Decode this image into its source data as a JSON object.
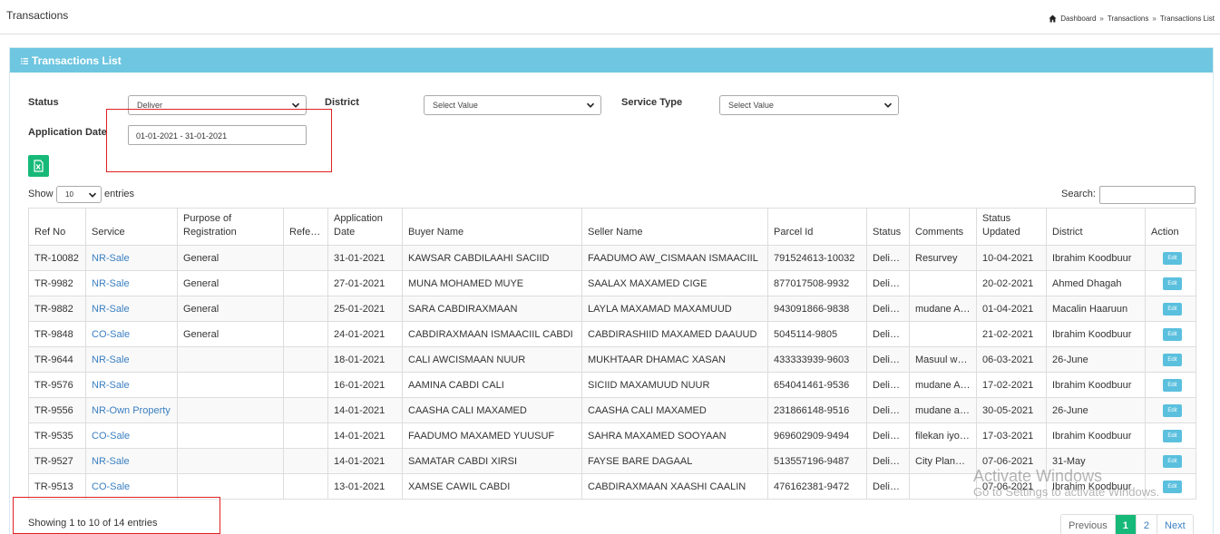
{
  "header": {
    "title": "Transactions",
    "breadcrumb": [
      "Dashboard",
      "Transactions",
      "Transactions List"
    ],
    "separator": "»"
  },
  "card": {
    "title": "Transactions List"
  },
  "filters": {
    "status_label": "Status",
    "status_value": "Deliver",
    "district_label": "District",
    "district_value": "Select Value",
    "service_type_label": "Service Type",
    "service_type_value": "Select Value",
    "date_label": "Application Date",
    "date_value": "01-01-2021 - 31-01-2021"
  },
  "table_controls": {
    "show_label": "Show",
    "entries_value": "10",
    "entries_label": "entries",
    "search_label": "Search:"
  },
  "table": {
    "columns": [
      "Ref No",
      "Service",
      "Purpose of Registration",
      "Referral",
      "Application Date",
      "Buyer Name",
      "Seller Name",
      "Parcel Id",
      "Status",
      "Comments",
      "Status Updated",
      "District",
      "Action"
    ],
    "edit_label": "Edit",
    "rows": [
      [
        "TR-10082",
        "NR-Sale",
        "General",
        "",
        "31-01-2021",
        "KAWSAR CABDILAAHI SACIID",
        "FAADUMO AW_CISMAAN ISMAACIIL",
        "791524613-10032",
        "Deliver",
        "Resurvey",
        "10-04-2021",
        "Ibrahim Koodbuur"
      ],
      [
        "TR-9982",
        "NR-Sale",
        "General",
        "",
        "27-01-2021",
        "MUNA MOHAMED MUYE",
        "SAALAX MAXAMED CIGE",
        "877017508-9932",
        "Deliver",
        "",
        "20-02-2021",
        "Ahmed Dhagah"
      ],
      [
        "TR-9882",
        "NR-Sale",
        "General",
        "",
        "25-01-2021",
        "SARA CABDIRAXMAAN",
        "LAYLA MAXAMAD MAXAMUUD",
        "943091866-9838",
        "Deliver",
        "mudane Ag...",
        "01-04-2021",
        "Macalin Haaruun"
      ],
      [
        "TR-9848",
        "CO-Sale",
        "General",
        "",
        "24-01-2021",
        "CABDIRAXMAAN ISMAACIIL CABDI",
        "CABDIRASHIID MAXAMED DAAUUD",
        "5045114-9805",
        "Deliver",
        "",
        "21-02-2021",
        "Ibrahim Koodbuur"
      ],
      [
        "TR-9644",
        "NR-Sale",
        "",
        "",
        "18-01-2021",
        "CALI AWCISMAAN NUUR",
        "MUKHTAAR DHAMAC XASAN",
        "433333939-9603",
        "Deliver",
        "Masuul wa...",
        "06-03-2021",
        "26-June"
      ],
      [
        "TR-9576",
        "NR-Sale",
        "",
        "",
        "16-01-2021",
        "AAMINA CABDI CALI",
        "SICIID MAXAMUUD NUUR",
        "654041461-9536",
        "Deliver",
        "mudane Ag...",
        "17-02-2021",
        "Ibrahim Koodbuur"
      ],
      [
        "TR-9556",
        "NR-Own Property",
        "",
        "",
        "14-01-2021",
        "CAASHA CALI MAXAMED",
        "CAASHA CALI MAXAMED",
        "231866148-9516",
        "Deliver",
        "mudane ag...",
        "30-05-2021",
        "26-June"
      ],
      [
        "TR-9535",
        "CO-Sale",
        "",
        "",
        "14-01-2021",
        "FAADUMO MAXAMED YUUSUF",
        "SAHRA MAXAMED SOOYAAN",
        "969602909-9494",
        "Deliver",
        "filekan iyo ...",
        "17-03-2021",
        "Ibrahim Koodbuur"
      ],
      [
        "TR-9527",
        "NR-Sale",
        "",
        "",
        "14-01-2021",
        "SAMATAR CABDI XIRSI",
        "FAYSE BARE DAGAAL",
        "513557196-9487",
        "Deliver",
        "City Planni...",
        "07-06-2021",
        "31-May"
      ],
      [
        "TR-9513",
        "CO-Sale",
        "",
        "",
        "13-01-2021",
        "XAMSE CAWIL CABDI",
        "CABDIRAXMAAN XAASHI CAALIN",
        "476162381-9472",
        "Deliver",
        "",
        "07-06-2021",
        "Ibrahim Koodbuur"
      ]
    ]
  },
  "footer": {
    "info": "Showing 1 to 10 of 14 entries",
    "pagination": {
      "prev": "Previous",
      "pages": [
        "1",
        "2"
      ],
      "next": "Next"
    }
  },
  "watermark": {
    "line1": "Activate Windows",
    "line2": "Go to Settings to activate Windows."
  },
  "colors": {
    "header_bar": "#6ec6e0",
    "accent_green": "#17b978",
    "link": "#3a7fc1",
    "edit_button": "#5bc0de",
    "highlight_red": "#e02020"
  }
}
